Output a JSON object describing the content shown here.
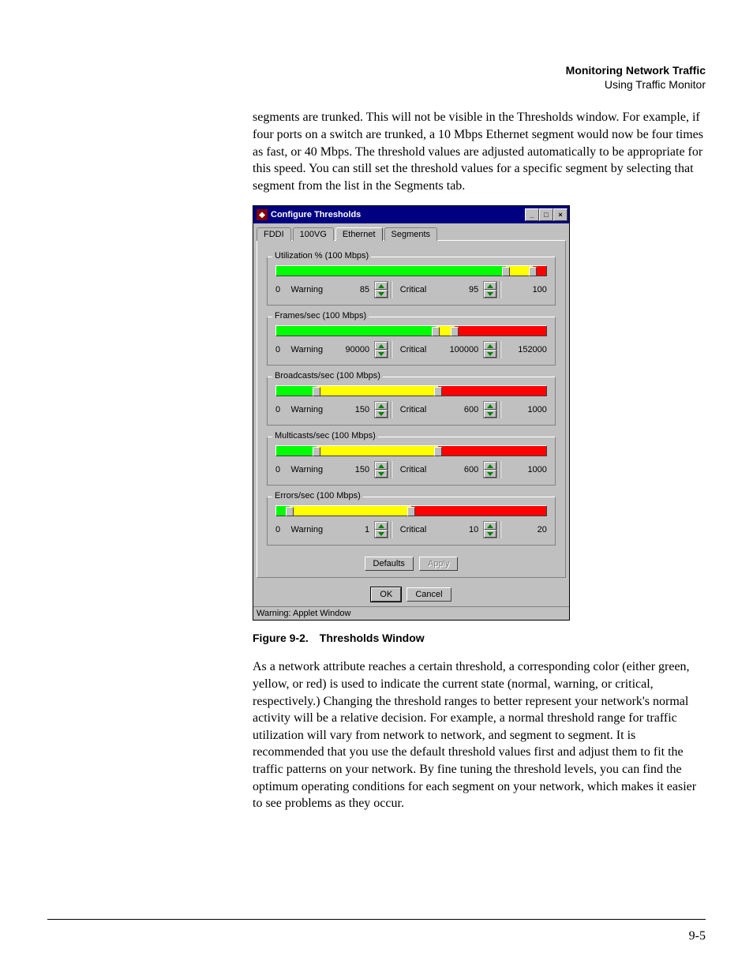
{
  "header": {
    "title": "Monitoring Network Traffic",
    "subtitle": "Using Traffic Monitor"
  },
  "para1": "segments are trunked. This will not be visible in the Thresholds window. For example, if four ports on a switch are trunked, a 10 Mbps Ethernet segment would now be four times as fast, or 40 Mbps. The threshold values are adjusted automatically to be appropriate for this speed. You can still set the threshold values for a specific segment by selecting that segment from the list in the Segments tab.",
  "dialog": {
    "title": "Configure Thresholds",
    "tabs": [
      "FDDI",
      "100VG",
      "Ethernet",
      "Segments"
    ],
    "active_tab": 2,
    "labels": {
      "warning": "Warning",
      "critical": "Critical",
      "defaults": "Defaults",
      "apply": "Apply",
      "ok": "OK",
      "cancel": "Cancel"
    },
    "groups": [
      {
        "title": "Utilization % (100 Mbps)",
        "min": "0",
        "warn": "85",
        "crit": "95",
        "max": "100",
        "wpct": 85,
        "cpct": 95
      },
      {
        "title": "Frames/sec (100 Mbps)",
        "min": "0",
        "warn": "90000",
        "crit": "100000",
        "max": "152000",
        "wpct": 59,
        "cpct": 66
      },
      {
        "title": "Broadcasts/sec (100 Mbps)",
        "min": "0",
        "warn": "150",
        "crit": "600",
        "max": "1000",
        "wpct": 15,
        "cpct": 60
      },
      {
        "title": "Multicasts/sec (100 Mbps)",
        "min": "0",
        "warn": "150",
        "crit": "600",
        "max": "1000",
        "wpct": 15,
        "cpct": 60
      },
      {
        "title": "Errors/sec (100 Mbps)",
        "min": "0",
        "warn": "1",
        "crit": "10",
        "max": "20",
        "wpct": 5,
        "cpct": 50
      }
    ],
    "status": "Warning: Applet Window"
  },
  "figcaption": "Figure 9-2. Thresholds Window",
  "para2": "As a network attribute reaches a certain threshold, a corresponding color (either green, yellow, or red) is used to indicate the current state (normal, warning, or critical, respectively.) Changing the threshold ranges to better represent your network's normal activity will be a relative decision. For example, a normal threshold range for traffic utilization will vary from network to network, and segment to segment. It is recommended that you use the default threshold values first and adjust them to fit the traffic patterns on your network. By fine tuning the threshold levels, you can find the optimum operating conditions for each segment on your network, which makes it easier to see problems as they occur.",
  "pagenum": "9-5"
}
